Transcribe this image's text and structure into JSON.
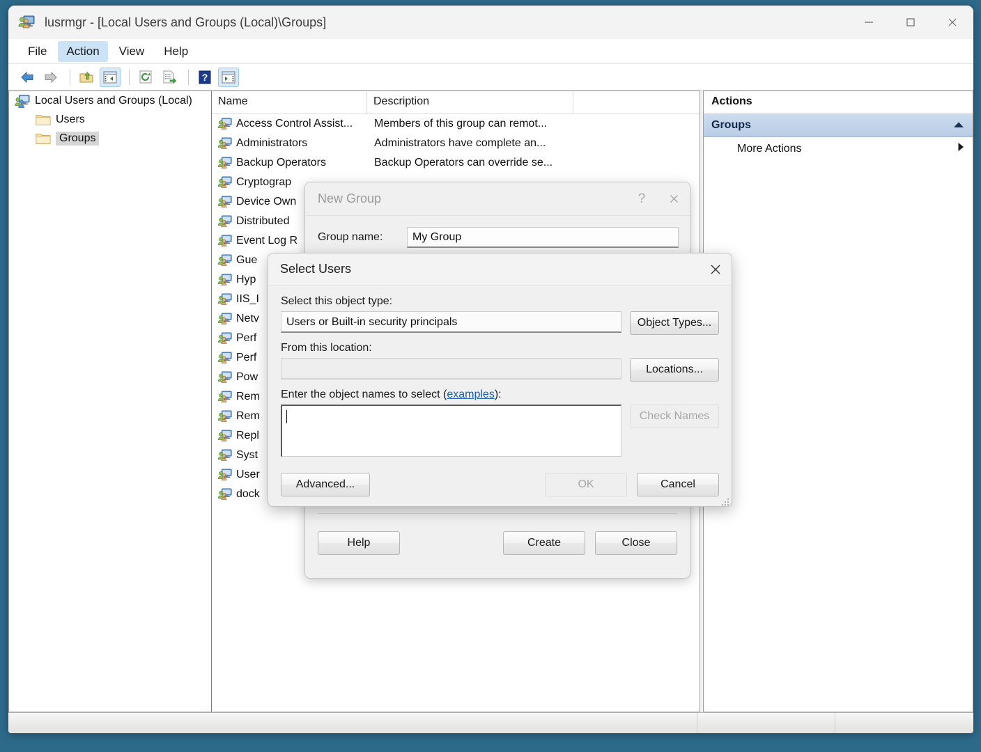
{
  "window": {
    "title": "lusrmgr - [Local Users and Groups (Local)\\Groups]",
    "icon": "local-users-and-groups-icon",
    "controls": {
      "minimize": "—",
      "maximize": "□",
      "close": "✕"
    }
  },
  "menu": {
    "items": [
      {
        "label": "File",
        "active": false
      },
      {
        "label": "Action",
        "active": true
      },
      {
        "label": "View",
        "active": false
      },
      {
        "label": "Help",
        "active": false
      }
    ]
  },
  "toolbar": {
    "buttons": [
      {
        "name": "back-icon",
        "pressed": false
      },
      {
        "name": "forward-icon",
        "pressed": false
      },
      {
        "name": "up-one-level-icon",
        "pressed": false
      },
      {
        "name": "show-hide-console-tree-icon",
        "pressed": true
      },
      {
        "name": "refresh-icon",
        "pressed": false
      },
      {
        "name": "export-list-icon",
        "pressed": false
      },
      {
        "name": "help-icon",
        "pressed": false
      },
      {
        "name": "show-hide-action-pane-icon",
        "pressed": true
      }
    ]
  },
  "tree": {
    "items": [
      {
        "label": "Local Users and Groups (Local)",
        "icon": "computer-icon",
        "level": 0,
        "selected": false
      },
      {
        "label": "Users",
        "icon": "folder-icon",
        "level": 1,
        "selected": false
      },
      {
        "label": "Groups",
        "icon": "folder-icon",
        "level": 1,
        "selected": true
      }
    ]
  },
  "list": {
    "columns": [
      "Name",
      "Description"
    ],
    "rows": [
      {
        "name": "Access Control Assist...",
        "desc": "Members of this group can remot..."
      },
      {
        "name": "Administrators",
        "desc": "Administrators have complete an..."
      },
      {
        "name": "Backup Operators",
        "desc": "Backup Operators can override se..."
      },
      {
        "name": "Cryptograp",
        "desc": ""
      },
      {
        "name": "Device Own",
        "desc": ""
      },
      {
        "name": "Distributed",
        "desc": ""
      },
      {
        "name": "Event Log R",
        "desc": ""
      },
      {
        "name": "Gue",
        "desc": ""
      },
      {
        "name": "Hyp",
        "desc": ""
      },
      {
        "name": "IIS_I",
        "desc": ""
      },
      {
        "name": "Netv",
        "desc": ""
      },
      {
        "name": "Perf",
        "desc": ""
      },
      {
        "name": "Perf",
        "desc": ""
      },
      {
        "name": "Pow",
        "desc": ""
      },
      {
        "name": "Rem",
        "desc": ""
      },
      {
        "name": "Rem",
        "desc": ""
      },
      {
        "name": "Repl",
        "desc": ""
      },
      {
        "name": "Syst",
        "desc": ""
      },
      {
        "name": "User",
        "desc": ""
      },
      {
        "name": "dock",
        "desc": ""
      }
    ]
  },
  "actions": {
    "title": "Actions",
    "group_header": "Groups",
    "collapse_icon": "chevron-up-icon",
    "items": [
      {
        "label": "More Actions",
        "submenu_icon": "chevron-right-icon"
      }
    ]
  },
  "new_group_dialog": {
    "title": "New Group",
    "help_glyph": "?",
    "close_glyph": "✕",
    "group_name_label": "Group name:",
    "group_name_value": "My Group",
    "buttons": {
      "help": "Help",
      "create": "Create",
      "close": "Close"
    }
  },
  "select_users_dialog": {
    "title": "Select Users",
    "close_glyph": "✕",
    "object_type_label": "Select this object type:",
    "object_type_value": "Users or Built-in security principals",
    "object_types_button": "Object Types...",
    "location_label": "From this location:",
    "location_value": "",
    "locations_button": "Locations...",
    "names_label_before": "Enter the object names to select (",
    "names_label_link": "examples",
    "names_label_after": "):",
    "names_value": "",
    "check_names_button": "Check Names",
    "advanced_button": "Advanced...",
    "ok_button": "OK",
    "cancel_button": "Cancel"
  },
  "status_bar": {
    "pane1": "",
    "pane2": "",
    "pane3": ""
  },
  "colors": {
    "desktop_background": "#2d6a8a",
    "menu_active": "#cce3f7",
    "toolbar_pressed": "#d6eaf9",
    "actions_group_header": "#c3d4e9",
    "link": "#1a5fb4",
    "tree_selection": "#d6d6d6"
  }
}
